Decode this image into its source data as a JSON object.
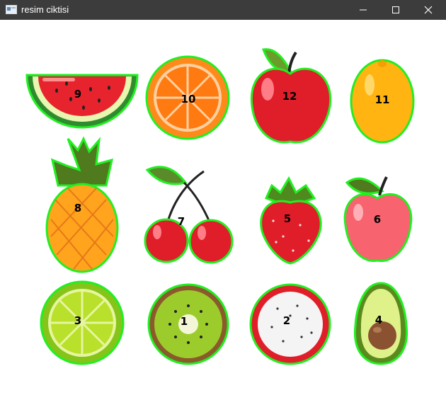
{
  "window": {
    "title": "resim ciktisi",
    "icon": "app-window-icon",
    "controls": {
      "minimize_icon": "minimize-icon",
      "maximize_icon": "maximize-icon",
      "close_icon": "close-icon"
    }
  },
  "colors": {
    "titlebar": "#3c3c3c",
    "contour": "#22ee22",
    "label": "#000000"
  },
  "fruits": [
    {
      "name": "watermelon",
      "label": "9"
    },
    {
      "name": "orange",
      "label": "10"
    },
    {
      "name": "red-apple",
      "label": "12"
    },
    {
      "name": "lemon",
      "label": "11"
    },
    {
      "name": "pineapple",
      "label": "8"
    },
    {
      "name": "cherry",
      "label": "7"
    },
    {
      "name": "strawberry",
      "label": "5"
    },
    {
      "name": "pink-apple",
      "label": "6"
    },
    {
      "name": "lime",
      "label": "3"
    },
    {
      "name": "kiwi",
      "label": "1"
    },
    {
      "name": "dragon-fruit",
      "label": "2"
    },
    {
      "name": "avocado",
      "label": "4"
    }
  ]
}
